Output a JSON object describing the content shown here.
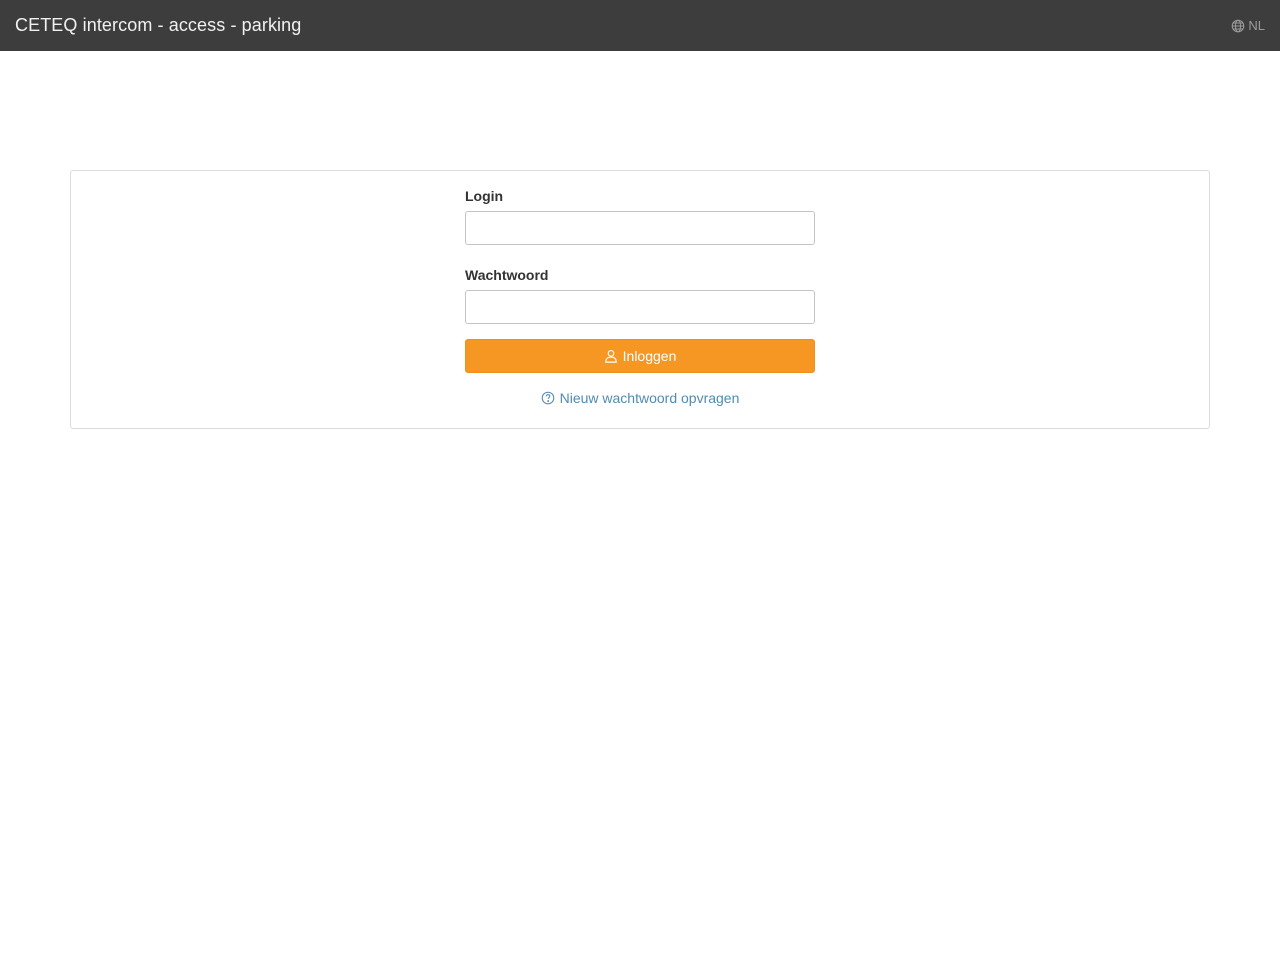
{
  "header": {
    "title": "CETEQ intercom - access - parking",
    "language": "NL",
    "language_icon": "globe-icon"
  },
  "login_form": {
    "login_label": "Login",
    "login_value": "",
    "password_label": "Wachtwoord",
    "password_value": "",
    "submit_label": "Inloggen",
    "submit_icon": "user-icon",
    "forgot_label": "Nieuw wachtwoord opvragen",
    "forgot_icon": "question-circle-icon"
  },
  "colors": {
    "navbar": "#3d3d3d",
    "accent": "#f59722",
    "link": "#4f8bb3"
  }
}
